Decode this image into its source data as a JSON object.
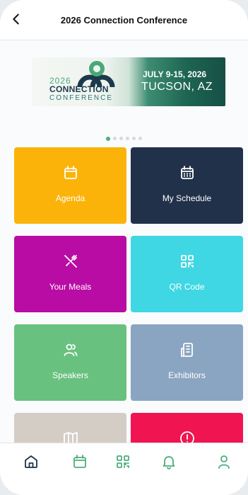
{
  "header": {
    "title": "2026 Connection Conference"
  },
  "banner": {
    "year": "2026",
    "name": "CONNECTION",
    "subtitle": "CONFERENCE",
    "dates": "JULY 9-15, 2026",
    "location": "TUCSON, AZ"
  },
  "carousel": {
    "total": 6,
    "active": 1
  },
  "tiles": [
    {
      "label": "Agenda",
      "icon": "calendar-icon",
      "color": "#fbb30a"
    },
    {
      "label": "My Schedule",
      "icon": "calendar-grid-icon",
      "color": "#22314a"
    },
    {
      "label": "Your Meals",
      "icon": "utensils-crossed-icon",
      "color": "#b80ca4"
    },
    {
      "label": "QR Code",
      "icon": "qr-code-icon",
      "color": "#3fd7e3"
    },
    {
      "label": "Speakers",
      "icon": "users-icon",
      "color": "#69c17f"
    },
    {
      "label": "Exhibitors",
      "icon": "building-icon",
      "color": "#8aa5c1"
    },
    {
      "label": "",
      "icon": "map-icon",
      "color": "#d4cdc6"
    },
    {
      "label": "",
      "icon": "alert-circle-icon",
      "color": "#f01551"
    }
  ],
  "tabbar": {
    "items": [
      {
        "name": "home",
        "icon": "home-icon",
        "active": true
      },
      {
        "name": "agenda",
        "icon": "calendar-icon",
        "active": false
      },
      {
        "name": "qr",
        "icon": "qr-code-icon",
        "active": false
      },
      {
        "name": "notifications",
        "icon": "bell-icon",
        "active": false
      },
      {
        "name": "profile",
        "icon": "user-icon",
        "active": false
      }
    ]
  },
  "colors": {
    "accent": "#4caf7a",
    "dark": "#22314a"
  }
}
